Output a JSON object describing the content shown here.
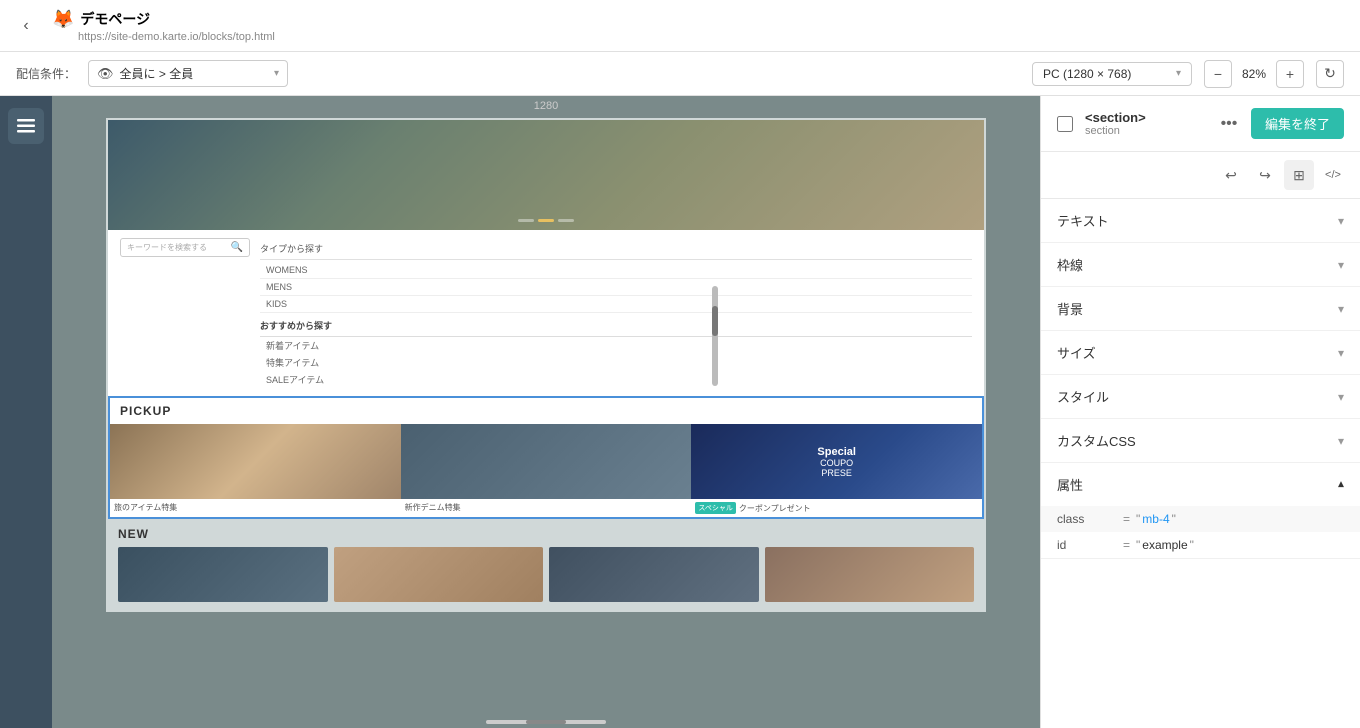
{
  "topbar": {
    "back_icon": "‹",
    "site_icon": "🦊",
    "site_name": "デモページ",
    "site_url": "https://site-demo.karte.io/blocks/top.html"
  },
  "toolbar": {
    "condition_label": "配信条件：",
    "eye_icon": "👁",
    "condition_value": "全員に > 全員",
    "device_label": "PC (1280 × 768)",
    "zoom_minus": "−",
    "zoom_value": "82%",
    "zoom_plus": "+",
    "refresh_icon": "↻"
  },
  "canvas": {
    "ruler_label": "1280",
    "pickup_heading": "PICKUP",
    "pickup_item1_caption": "旅のアイテム特集",
    "pickup_item2_caption": "新作デニム特集",
    "pickup_item3_badge": "スペシャル",
    "pickup_item3_caption": "クーポンプレゼント",
    "coupon_line1": "Special",
    "coupon_line2": "COUPO",
    "coupon_line3": "PRESE",
    "new_heading": "NEW",
    "search_placeholder": "キーワードを検索する",
    "nav_type_label": "タイプから探す",
    "nav_womens": "WOMENS",
    "nav_mens": "MENS",
    "nav_kids": "KIDS",
    "nav_recommend_label": "おすすめから探す",
    "nav_new_item": "新着アイテム",
    "nav_special_item": "特集アイテム",
    "nav_sale_item": "SALEアイテム"
  },
  "right_panel": {
    "element_tag": "<section>",
    "element_sub": "section",
    "more_icon": "•••",
    "edit_button_label": "編集を終了",
    "undo_icon": "↩",
    "redo_icon": "↪",
    "grid_icon": "⊞",
    "code_icon": "</>",
    "sections": [
      {
        "label": "テキスト",
        "key": "text-section"
      },
      {
        "label": "枠線",
        "key": "border-section"
      },
      {
        "label": "背景",
        "key": "background-section"
      },
      {
        "label": "サイズ",
        "key": "size-section"
      },
      {
        "label": "スタイル",
        "key": "style-section"
      },
      {
        "label": "カスタムCSS",
        "key": "custom-css-section"
      }
    ],
    "attributes_label": "属性",
    "attributes_open": true,
    "attr_class_key": "class",
    "attr_class_eq": "=",
    "attr_class_val": "mb-4",
    "attr_id_key": "id",
    "attr_id_eq": "=",
    "attr_id_val": "example"
  }
}
